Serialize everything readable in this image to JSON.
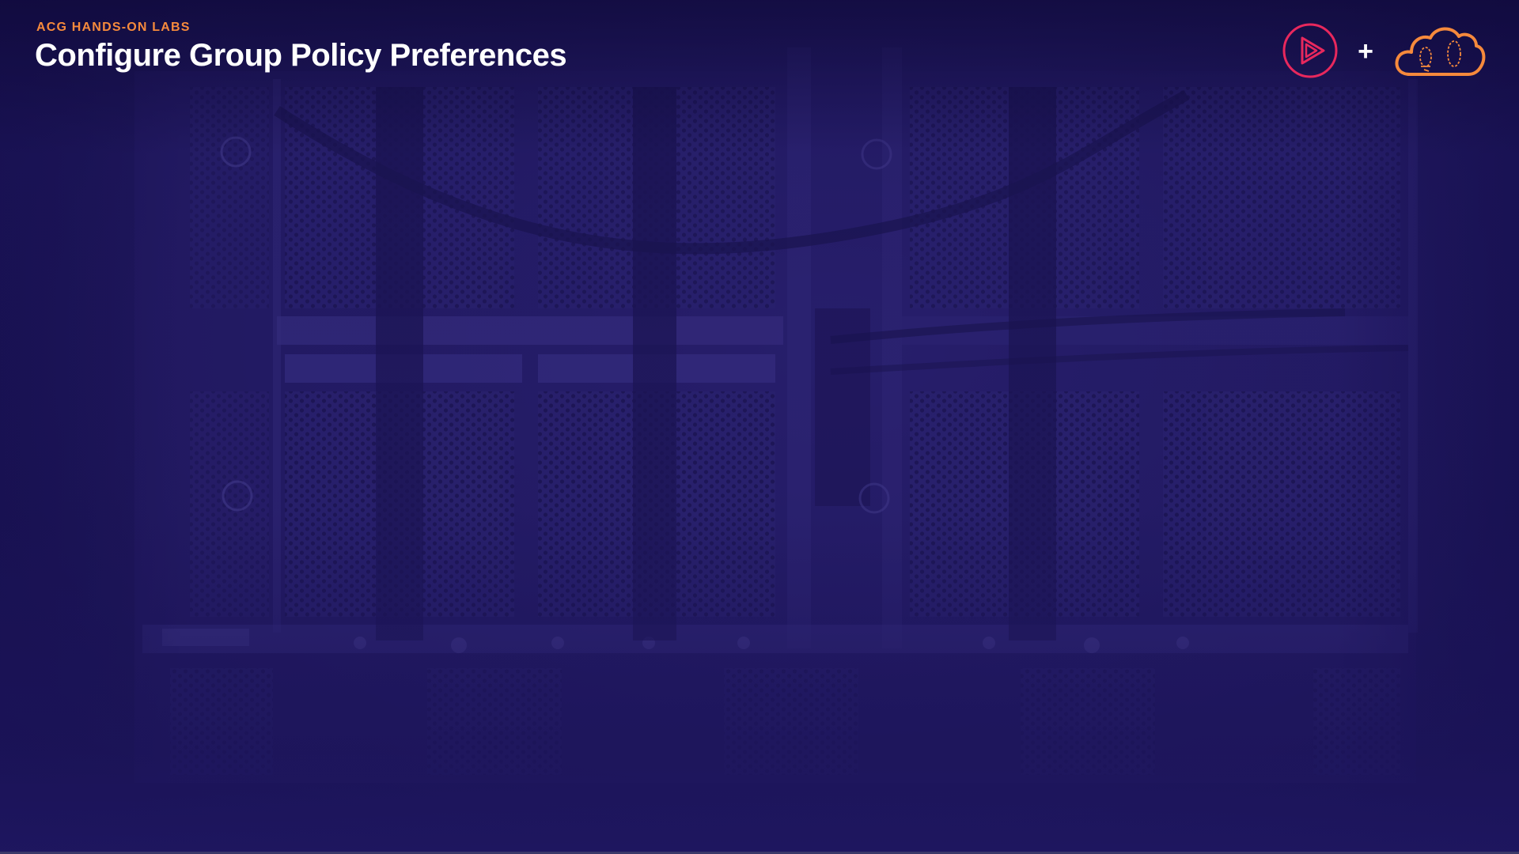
{
  "slide": {
    "eyebrow": "ACG HANDS-ON LABS",
    "title": "Configure Group Policy Preferences"
  },
  "logos": {
    "pluralsight": "pluralsight-play-icon",
    "plus": "+",
    "acg": "acloudguru-cloud-icon"
  },
  "colors": {
    "background": "#1e1660",
    "eyebrow": "#f68a3c",
    "title": "#ffffff",
    "pluralsight_accent": "#e8285d",
    "acg_accent": "#f68a3c"
  }
}
